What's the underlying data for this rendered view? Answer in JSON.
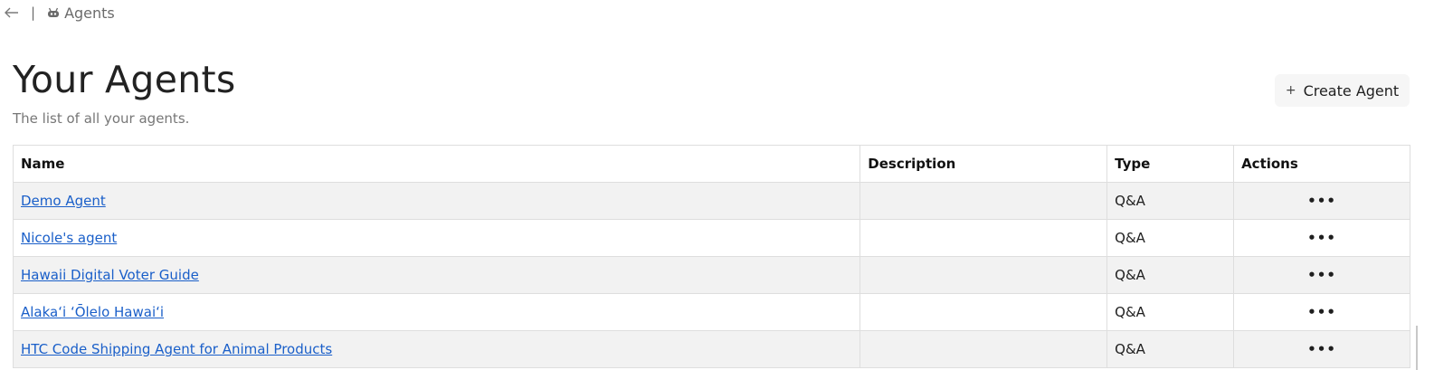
{
  "nav": {
    "separator": "|",
    "breadcrumb_label": "Agents"
  },
  "header": {
    "title": "Your Agents",
    "subtitle": "The list of all your agents.",
    "create_plus": "+",
    "create_label": "Create Agent"
  },
  "table": {
    "columns": [
      "Name",
      "Description",
      "Type",
      "Actions"
    ],
    "rows": [
      {
        "name": "Demo Agent",
        "description": "",
        "type": "Q&A",
        "actions": "•••"
      },
      {
        "name": "Nicole's agent",
        "description": "",
        "type": "Q&A",
        "actions": "•••"
      },
      {
        "name": "Hawaii Digital Voter Guide",
        "description": "",
        "type": "Q&A",
        "actions": "•••"
      },
      {
        "name": "Alakaʻi ʻŌlelo Hawaiʻi",
        "description": "",
        "type": "Q&A",
        "actions": "•••"
      },
      {
        "name": "HTC Code Shipping Agent for Animal Products",
        "description": "",
        "type": "Q&A",
        "actions": "•••"
      }
    ]
  },
  "colors": {
    "link": "#1a5fc9",
    "row_alt": "#f2f2f2",
    "border": "#dedede"
  }
}
